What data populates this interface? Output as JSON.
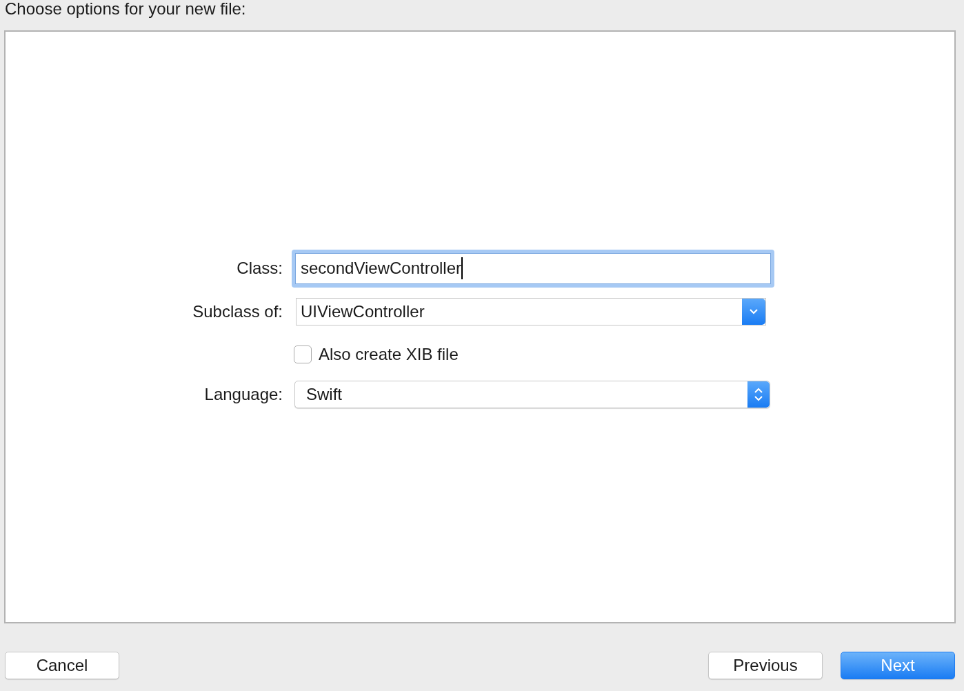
{
  "title": "Choose options for your new file:",
  "rows": [
    {
      "kind": "text",
      "label": "Class:",
      "value": "secondViewController",
      "focused": true
    },
    {
      "kind": "combo",
      "label": "Subclass of:",
      "value": "UIViewController"
    },
    {
      "kind": "checkbox",
      "label": "Also create XIB file",
      "checked": false
    },
    {
      "kind": "popup",
      "label": "Language:",
      "value": "Swift"
    }
  ],
  "buttons": [
    {
      "label": "Cancel",
      "default": false
    },
    {
      "label": "Previous",
      "default": false
    },
    {
      "label": "Next",
      "default": true
    }
  ]
}
